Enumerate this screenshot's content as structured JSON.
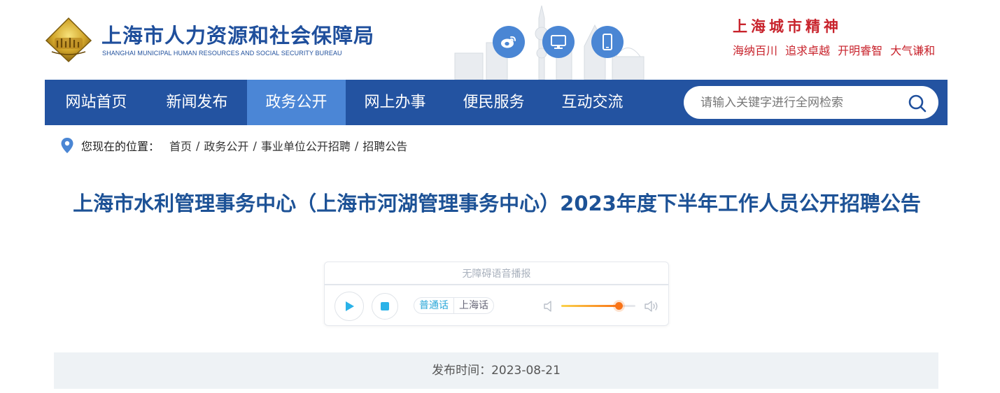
{
  "header": {
    "org_name_cn": "上海市人力资源和社会保障局",
    "org_name_en": "SHANGHAI MUNICIPAL HUMAN RESOURCES AND SOCIAL SECURITY BUREAU",
    "social_icons": [
      "weibo-icon",
      "desktop-icon",
      "mobile-icon"
    ],
    "city_spirit": {
      "title": "上海城市精神",
      "motto": "海纳百川 追求卓越 开明睿智 大气谦和"
    }
  },
  "nav": {
    "items": [
      {
        "label": "网站首页",
        "active": false
      },
      {
        "label": "新闻发布",
        "active": false
      },
      {
        "label": "政务公开",
        "active": true
      },
      {
        "label": "网上办事",
        "active": false
      },
      {
        "label": "便民服务",
        "active": false
      },
      {
        "label": "互动交流",
        "active": false
      }
    ],
    "search_placeholder": "请输入关键字进行全网检索"
  },
  "breadcrumb": {
    "label": "您现在的位置：",
    "items": [
      "首页",
      "政务公开",
      "事业单位公开招聘",
      "招聘公告"
    ],
    "separator": "/"
  },
  "article": {
    "title": "上海市水利管理事务中心（上海市河湖管理事务中心）2023年度下半年工作人员公开招聘公告",
    "publish_label": "发布时间：",
    "publish_date": "2023-08-21"
  },
  "player": {
    "title": "无障碍语音播报",
    "dialects": [
      "普通话",
      "上海话"
    ],
    "active_dialect": "普通话",
    "volume_fraction": 0.77
  },
  "colors": {
    "nav_bg": "#2353a1",
    "nav_active": "#4b86d6",
    "title": "#1d5296",
    "spirit": "#c8232c",
    "social": "#4a86d4"
  }
}
